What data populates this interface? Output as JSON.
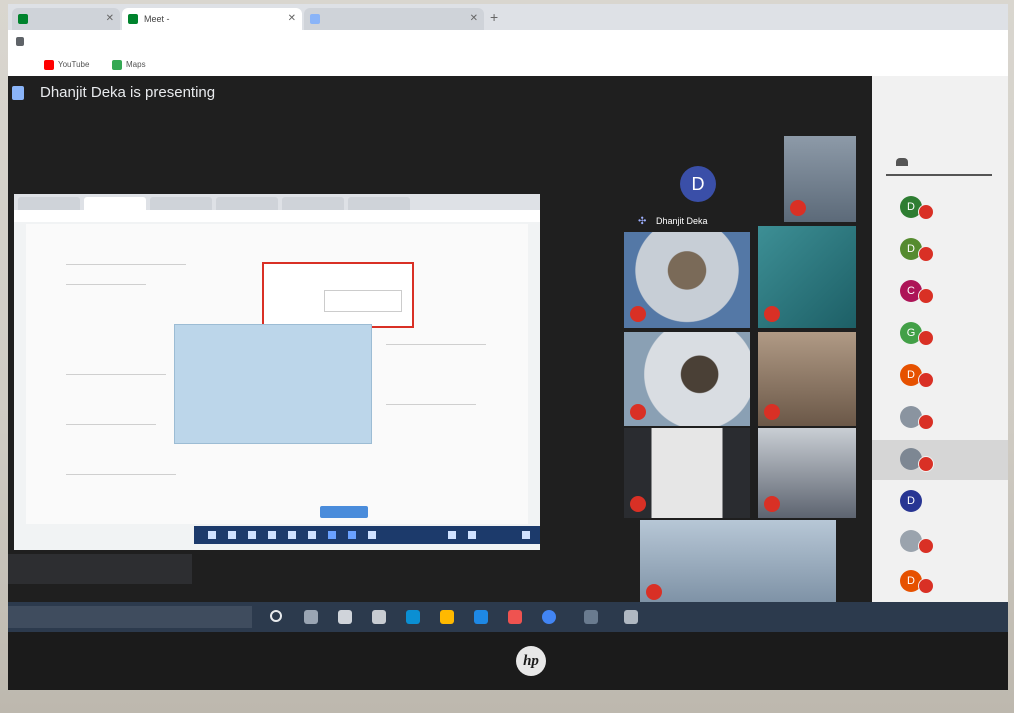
{
  "browser": {
    "tabs": [
      {
        "label": "",
        "active": false
      },
      {
        "label": "Meet - ",
        "active": true
      },
      {
        "label": "",
        "active": false
      }
    ],
    "new_tab": "+",
    "url": "",
    "bookmarks": [
      {
        "label": "YouTube",
        "color": "#ff0000"
      },
      {
        "label": "Maps",
        "color": "#34a853"
      }
    ]
  },
  "meet": {
    "presenting_text": "Dhanjit Deka is presenting",
    "caption": "",
    "self_tile": {
      "initial": "D",
      "name": "Dhanjit Deka",
      "color": "#3a4fa8"
    },
    "tiles": [
      {
        "name": "",
        "bg": "#6b7f93"
      },
      {
        "name": "",
        "bg": "#7a6a58"
      },
      {
        "name": "",
        "bg": "#2e7f86"
      },
      {
        "name": "",
        "bg": "#8aa0b4"
      },
      {
        "name": "",
        "bg": "#7a6657"
      },
      {
        "name": "",
        "bg": "#e6e6e6"
      },
      {
        "name": "",
        "bg": "#5d6470"
      },
      {
        "name": "",
        "bg": "#9bb0c4"
      }
    ],
    "people_panel": {
      "title": "",
      "tab_label": "",
      "participants": [
        {
          "initial": "D",
          "name": "",
          "color": "#2e7d32"
        },
        {
          "initial": "D",
          "name": "",
          "color": "#558b2f"
        },
        {
          "initial": "C",
          "name": "",
          "color": "#ad1457"
        },
        {
          "initial": "G",
          "name": "",
          "color": "#43a047"
        },
        {
          "initial": "D",
          "name": "",
          "color": "#e65100"
        },
        {
          "initial": "",
          "name": "",
          "color": "#8a94a0"
        },
        {
          "initial": "",
          "name": "",
          "color": "#7d8793"
        },
        {
          "initial": "D",
          "name": "",
          "color": "#283593"
        },
        {
          "initial": "",
          "name": "",
          "color": "#9aa3ad"
        },
        {
          "initial": "D",
          "name": "",
          "color": "#e65100"
        }
      ]
    }
  },
  "laptop": {
    "brand": "hp"
  }
}
